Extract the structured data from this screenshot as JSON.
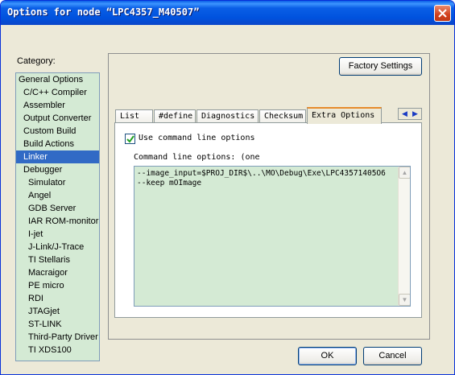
{
  "window": {
    "title": "Options for node “LPC4357_M40507”"
  },
  "category": {
    "label": "Category:",
    "items": [
      {
        "label": "General Options",
        "level": 0
      },
      {
        "label": "C/C++ Compiler",
        "level": 1
      },
      {
        "label": "Assembler",
        "level": 1
      },
      {
        "label": "Output Converter",
        "level": 1
      },
      {
        "label": "Custom Build",
        "level": 1
      },
      {
        "label": "Build Actions",
        "level": 1
      },
      {
        "label": "Linker",
        "level": 1,
        "selected": true
      },
      {
        "label": "Debugger",
        "level": 1
      },
      {
        "label": "Simulator",
        "level": 2
      },
      {
        "label": "Angel",
        "level": 2
      },
      {
        "label": "GDB Server",
        "level": 2
      },
      {
        "label": "IAR ROM-monitor",
        "level": 2
      },
      {
        "label": "I-jet",
        "level": 2
      },
      {
        "label": "J-Link/J-Trace",
        "level": 2
      },
      {
        "label": "TI Stellaris",
        "level": 2
      },
      {
        "label": "Macraigor",
        "level": 2
      },
      {
        "label": "PE micro",
        "level": 2
      },
      {
        "label": "RDI",
        "level": 2
      },
      {
        "label": "JTAGjet",
        "level": 2
      },
      {
        "label": "ST-LINK",
        "level": 2
      },
      {
        "label": "Third-Party Driver",
        "level": 2
      },
      {
        "label": "TI XDS100",
        "level": 2
      }
    ]
  },
  "factory_settings_label": "Factory Settings",
  "tabs": [
    {
      "label": "List"
    },
    {
      "label": "#define"
    },
    {
      "label": "Diagnostics"
    },
    {
      "label": "Checksum"
    },
    {
      "label": "Extra Options",
      "active": true
    }
  ],
  "tab_scroll": {
    "left": "◀",
    "right": "▶"
  },
  "extra_options": {
    "use_cmdline_label": "Use command line options",
    "use_cmdline_checked": true,
    "cmdline_label": "Command line options:  (one",
    "lines": [
      "--image_input=$PROJ_DIR$\\..\\MO\\Debug\\Exe\\LPC43571405O6",
      "--keep mOImage"
    ]
  },
  "buttons": {
    "ok": "OK",
    "cancel": "Cancel"
  },
  "colors": {
    "titlebar": "#0a5fe6",
    "selection": "#316ac5",
    "list_background": "#d4ead4",
    "dialog_background": "#ece9d8"
  }
}
